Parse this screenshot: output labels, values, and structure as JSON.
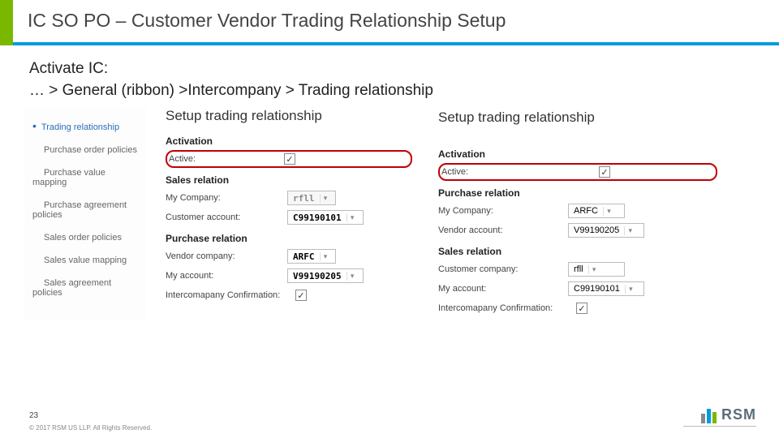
{
  "header": {
    "title": "IC SO PO – Customer Vendor Trading Relationship Setup"
  },
  "breadcrumb": {
    "line1": "Activate IC:",
    "line2": "… > General (ribbon) >Intercompany > Trading relationship"
  },
  "sidebar": {
    "items": [
      {
        "label": "Trading relationship",
        "active": true
      },
      {
        "label": "Purchase order policies",
        "active": false
      },
      {
        "label": "Purchase value mapping",
        "active": false
      },
      {
        "label": "Purchase agreement policies",
        "active": false
      },
      {
        "label": "Sales order policies",
        "active": false
      },
      {
        "label": "Sales value mapping",
        "active": false
      },
      {
        "label": "Sales agreement policies",
        "active": false
      }
    ]
  },
  "center": {
    "title": "Setup trading relationship",
    "sections": {
      "activation": {
        "header": "Activation",
        "active_label": "Active:",
        "active_checked": true
      },
      "sales_rel": {
        "header": "Sales relation",
        "my_company_label": "My Company:",
        "my_company_value": "rfll",
        "cust_acct_label": "Customer account:",
        "cust_acct_value": "C99190101"
      },
      "purchase_rel": {
        "header": "Purchase relation",
        "vendor_co_label": "Vendor company:",
        "vendor_co_value": "ARFC",
        "my_acct_label": "My account:",
        "my_acct_value": "V99190205",
        "confirm_label": "Intercomapany Confirmation:",
        "confirm_checked": true
      }
    }
  },
  "right": {
    "title": "Setup trading relationship",
    "sections": {
      "activation": {
        "header": "Activation",
        "active_label": "Active:",
        "active_checked": true
      },
      "purchase_rel": {
        "header": "Purchase relation",
        "my_company_label": "My Company:",
        "my_company_value": "ARFC",
        "vendor_acct_label": "Vendor account:",
        "vendor_acct_value": "V99190205"
      },
      "sales_rel": {
        "header": "Sales relation",
        "cust_co_label": "Customer company:",
        "cust_co_value": "rfll",
        "my_acct_label": "My account:",
        "my_acct_value": "C99190101",
        "confirm_label": "Intercomapany Confirmation:",
        "confirm_checked": true
      }
    }
  },
  "footer": {
    "page_no": "23",
    "copyright": "© 2017 RSM US LLP. All Rights Reserved.",
    "logo_name": "RSM"
  }
}
